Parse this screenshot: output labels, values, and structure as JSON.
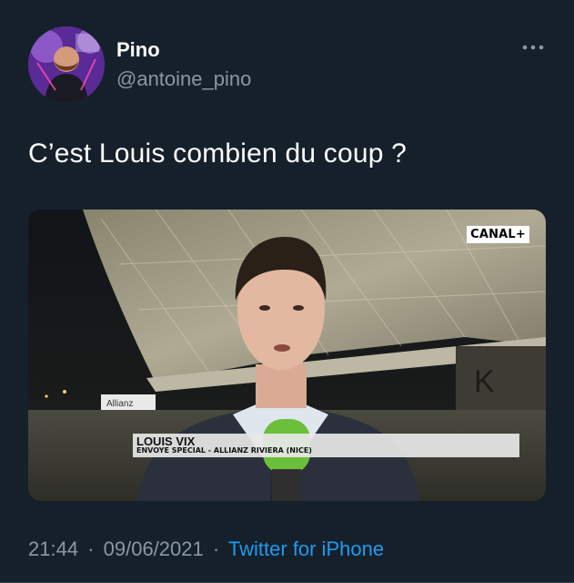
{
  "author": {
    "display_name": "Pino",
    "handle": "@antoine_pino"
  },
  "tweet": {
    "text": "C’est Louis combien du coup ?"
  },
  "media": {
    "channel_badge": "CANAL+",
    "lower_third_name": "LOUIS VIX",
    "lower_third_role": "ENVOYE SPECIAL - ALLIANZ RIVIERA (NICE)"
  },
  "meta": {
    "time": "21:44",
    "date": "09/06/2021",
    "separator": "·",
    "source": "Twitter for iPhone"
  },
  "icons": [
    "more-icon"
  ],
  "colors": {
    "background": "#15202b",
    "secondary_text": "#8899a6",
    "link": "#1d9bf0"
  }
}
